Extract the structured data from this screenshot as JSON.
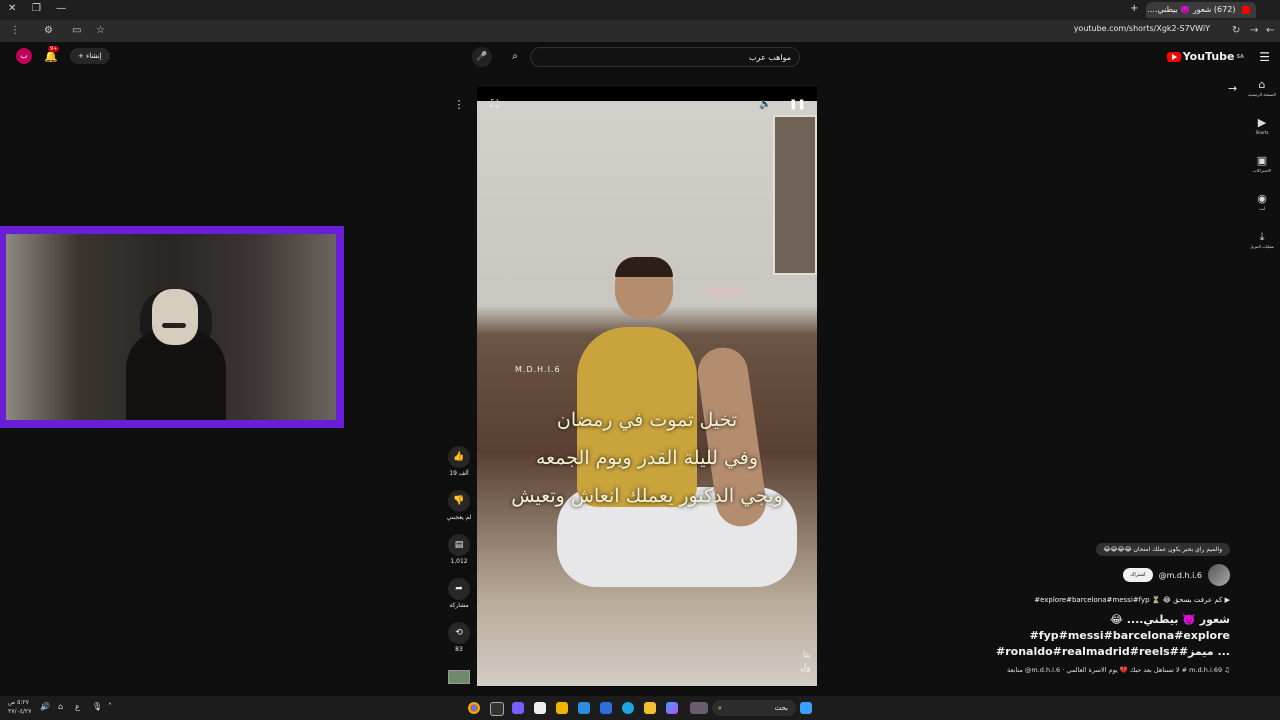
{
  "browser": {
    "tab_title": "(672) شعور 👿 بيطني....",
    "url": "youtube.com/shorts/Xgk2-S7VWiY"
  },
  "youtube": {
    "logo_text": "YouTube",
    "logo_region": "SA",
    "search_value": "مواهب عرب",
    "search_inline": "",
    "create_label": "إنشاء",
    "notif_count": "9+",
    "avatar_letter": "ب"
  },
  "sidenav": {
    "items": [
      {
        "label": "الصفحة الرئيسية",
        "icon": "home-icon"
      },
      {
        "label": "Shorts",
        "icon": "shorts-icon"
      },
      {
        "label": "الاشتراكات",
        "icon": "subscriptions-icon"
      },
      {
        "label": "أنت",
        "icon": "you-icon"
      },
      {
        "label": "عمليات التنزيل",
        "icon": "download-icon"
      }
    ]
  },
  "video": {
    "caption_line1": "تخيل تموت في رمضان",
    "caption_line2": "وفي لليلة القدر ويوم الجمعه",
    "caption_line3": "ويجي الدكتور يعملك انعاش وتعيش",
    "watermark": "M.D.H.I.6",
    "channel_mark": "سمسم الكوره",
    "corner_text": "يتا\nول"
  },
  "actions": {
    "like_count": "19 ألف",
    "dislike_label": "لم يعجبني",
    "comment_count": "1,012",
    "share_label": "مشاركة",
    "remix_count": "83"
  },
  "meta": {
    "top_comment": "والميم راي بحبر يكون عملك امتحان 😂😂😂😂",
    "channel_handle": "@m.d.h.i.6",
    "subscribe_label": "اشتراك",
    "ticker": "▶ كم عرفت بسحق 😂 ⏳ explore#barcelona#messi#fyp#",
    "title_line1": "شعور 👿 بيطني.... 😂",
    "title_line2": "#fyp#messi#barcelona#explore",
    "title_line3": "#ronaldo#realmadrid#reels##ميمز ...",
    "music": "♫ m.d.h.i.69 # لا تستاهل بعد حبك 💔 يوم الاسرة العالمي · m.d.h.i.6@ متابعة"
  },
  "taskbar": {
    "search_placeholder": "بحث",
    "clock_time": "٥:٢٧ ص",
    "clock_date": "٢٧/٠٤/٢٧",
    "lang": "ع"
  },
  "colors": {
    "webcam_border": "#6a1fd6",
    "youtube_red": "#ff0000",
    "background": "#0f0f0f"
  }
}
